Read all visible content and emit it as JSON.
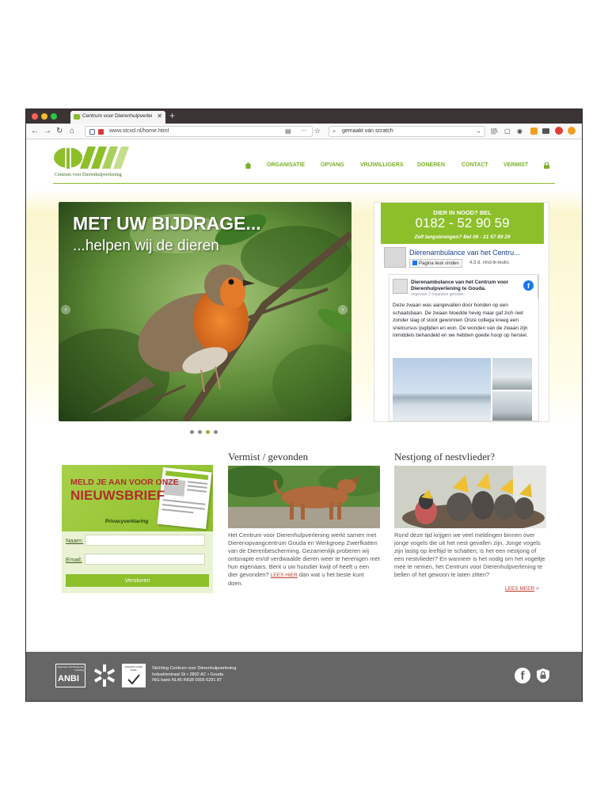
{
  "browser": {
    "tab_title": "Centrum voor Dierenhulpverleni",
    "tab_close": "✕",
    "new_tab": "+",
    "url": "www.stcvd.nl/home.html",
    "search_query": "gemaakt van scratch",
    "colors": {
      "tabbar": "#3a3434",
      "close_dot": "#ff5f57",
      "min_dot": "#febc2e",
      "max_dot": "#28c840"
    }
  },
  "site": {
    "logo_text": "Centrum voor Dierenhulpverlening",
    "nav": [
      "ORGANISATIE",
      "OPVANG",
      "VRIJWILLIGERS",
      "DONEREN",
      "CONTACT",
      "VERMIST"
    ],
    "accent": "#8cbf2a"
  },
  "hero": {
    "headline": "MET UW BIJDRAGE...",
    "subline": "...helpen wij de dieren",
    "active_slide": 3,
    "slide_count": 4
  },
  "emergency": {
    "title": "DIER IN NOOD? BEL",
    "phone": "0182 - 52 90 59",
    "subtitle": "Zelf langsbrengen? Bel 06 - 21 57 89 29"
  },
  "facebook": {
    "page_name": "Dierenambulance van het Centru...",
    "like_button": "Pagina leuk vinden",
    "likes": "4,3 d. vind-ik-leuks",
    "post_author": "Dierenambulance van het Centrum voor Dierenhulpverlening te Gouda.",
    "post_time": "ongeveer 2 maanden geleden",
    "post_text": "Deze zwaan was aangevallen door honden op een schaatsbaan. De zwaan bloedde hevig maar gaf zich niet zonder slag of stoot gewonnen Onze collega kreeg een snelcursus ijsglijden en won. De wonden van de zwaan zijn inmiddels behandeld en we hebben goede hoop op herstel."
  },
  "newsletter": {
    "line1": "MELD JE AAN VOOR ONZE",
    "line2": "NIEUWSBRIEF",
    "privacy": "Privacyverklaring",
    "name_label": "Naam:",
    "email_label": "Email:",
    "submit": "Versturen"
  },
  "vermist": {
    "title": "Vermist / gevonden",
    "text": "Het Centrum voor Dierenhulpverlening werkt samen met Dierenopvangcentrum Gouda en Werkgroep Zwerfkatten van de Dierenbescherming. Gezamenlijk proberen wij ontsnapte en/of verdwaalde dieren weer te herenigen met hun eigenaars. Bent u uw huisdier kwijt of heeft u een dier gevonden?",
    "read_more": "LEES HIER",
    "text_after": "dan wat u het beste kunt doen."
  },
  "nestjong": {
    "title": "Nestjong of nestvlieder?",
    "text": "Rond deze tijd krijgen we veel meldingen binnen over jonge vogels die uit het nest gevallen zijn. Jonge vogels zijn lastig op leeftijd te schatten; is het een nestjong of een nestvlieder? En wanneer is het nodig om het vogeltje mee te nemen, het Centrum voor Dierenhulpverlening te bellen of het gewoon te laten zitten?",
    "read_more": "LEES MEER"
  },
  "footer": {
    "anbi": "ANBI",
    "anbi_small": "Algemeen Nut Beogende Instelling",
    "seal_text": "ERKEND GOED DOEL",
    "info": [
      "Stichting Centrum voor Dierenhulpverlening",
      "Industriestraat 1b • 2802 AC • Gouda",
      "ING bank   NL45 INGB 0005 6291 87"
    ]
  }
}
